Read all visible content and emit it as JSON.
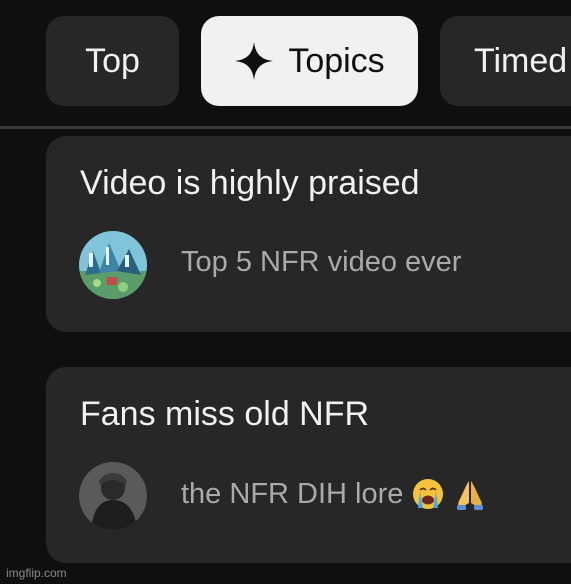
{
  "chips": {
    "top_label": "Top",
    "topics_label": "Topics",
    "timed_label": "Timed"
  },
  "cards": [
    {
      "title": "Video is highly praised",
      "comment": "Top 5 NFR video ever"
    },
    {
      "title": "Fans miss old NFR",
      "comment": "the NFR DIH lore"
    }
  ],
  "icons": {
    "topics_chip": "sparkle-icon",
    "card_2_emojis": [
      "loudly-crying-face-emoji",
      "folded-hands-emoji"
    ]
  },
  "colors": {
    "background": "#0f0f0f",
    "chip": "#272727",
    "chip_selected": "#f1f1f1",
    "card": "#272727",
    "title_text": "#f1f1f1",
    "comment_text": "#aaaaaa"
  },
  "watermark": "imgflip.com"
}
